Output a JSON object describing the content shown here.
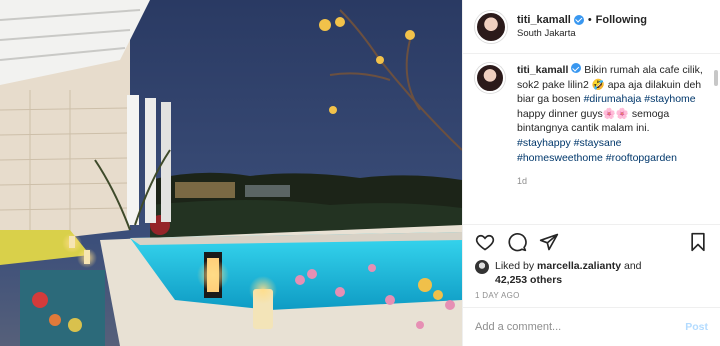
{
  "header": {
    "username": "titi_kamall",
    "separator": "•",
    "follow_label": "Following",
    "location": "South Jakarta"
  },
  "caption": {
    "username": "titi_kamall",
    "text1": " Bikin rumah ala cafe cilik, sok2 pake lilin2 ",
    "emoji1": "🤣",
    "text2": " apa aja dilakuin deh biar ga bosen ",
    "tag1": "#dirumahaja",
    "tag2": "#stayhome",
    "text3": " happy dinner guys",
    "emoji2": "🌸🌸",
    "text4": " semoga bintangnya cantik malam ini. ",
    "tag3": "#stayhappy",
    "tag4": "#staysane",
    "tag5": "#homesweethome",
    "tag6": "#rooftopgarden",
    "time_ago": "1d"
  },
  "likes": {
    "prefix": "Liked by ",
    "user": "marcella.zalianty",
    "mid": " and",
    "count": "42,253 others"
  },
  "post_date": "1 DAY AGO",
  "comment": {
    "placeholder": "Add a comment...",
    "post_label": "Post"
  },
  "icons": {
    "verified": "verified-badge-icon",
    "like": "heart-icon",
    "comment": "comment-icon",
    "share": "share-icon",
    "save": "bookmark-icon"
  },
  "colors": {
    "hashtag": "#00376b",
    "verified": "#3897f0",
    "post_disabled": "#b3dbff",
    "muted": "#8e8e8e"
  }
}
